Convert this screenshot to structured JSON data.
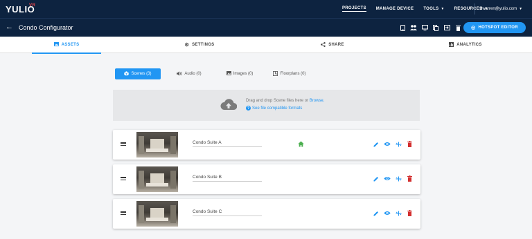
{
  "brand": {
    "logo": "YULIO",
    "logo_sup": "VR"
  },
  "nav": {
    "items": [
      {
        "label": "PROJECTS"
      },
      {
        "label": "MANAGE DEVICE"
      },
      {
        "label": "TOOLS"
      },
      {
        "label": "RESOURCES"
      }
    ],
    "user": "dwarren@yulio.com"
  },
  "project": {
    "title": "Condo Configurator",
    "hotspot_button": "HOTSPOT EDITOR"
  },
  "toolbar_icons": [
    "tablet-icon",
    "people-icon",
    "desktop-icon",
    "copy-icon",
    "export-icon",
    "trash-icon"
  ],
  "tabs": [
    {
      "label": "ASSETS",
      "icon": "image-icon"
    },
    {
      "label": "SETTINGS",
      "icon": "gear-icon"
    },
    {
      "label": "SHARE",
      "icon": "share-icon"
    },
    {
      "label": "ANALYTICS",
      "icon": "chart-icon"
    }
  ],
  "filters": [
    {
      "label": "Scenes (3)",
      "icon": "cube-icon"
    },
    {
      "label": "Audio (0)",
      "icon": "speaker-icon"
    },
    {
      "label": "Images (0)",
      "icon": "image-icon"
    },
    {
      "label": "Floorplans (0)",
      "icon": "floorplan-icon"
    }
  ],
  "dropzone": {
    "text": "Drag and drop Scene files here or ",
    "link": "Browse.",
    "help": "See file compatible formats"
  },
  "scenes": [
    {
      "name": "Condo Suite A",
      "is_home": true
    },
    {
      "name": "Condo Suite B",
      "is_home": false
    },
    {
      "name": "Condo Suite C",
      "is_home": false
    }
  ],
  "colors": {
    "navbar": "#0d2340",
    "accent": "#2196f3",
    "home": "#4caf50",
    "delete": "#d32f2f"
  }
}
